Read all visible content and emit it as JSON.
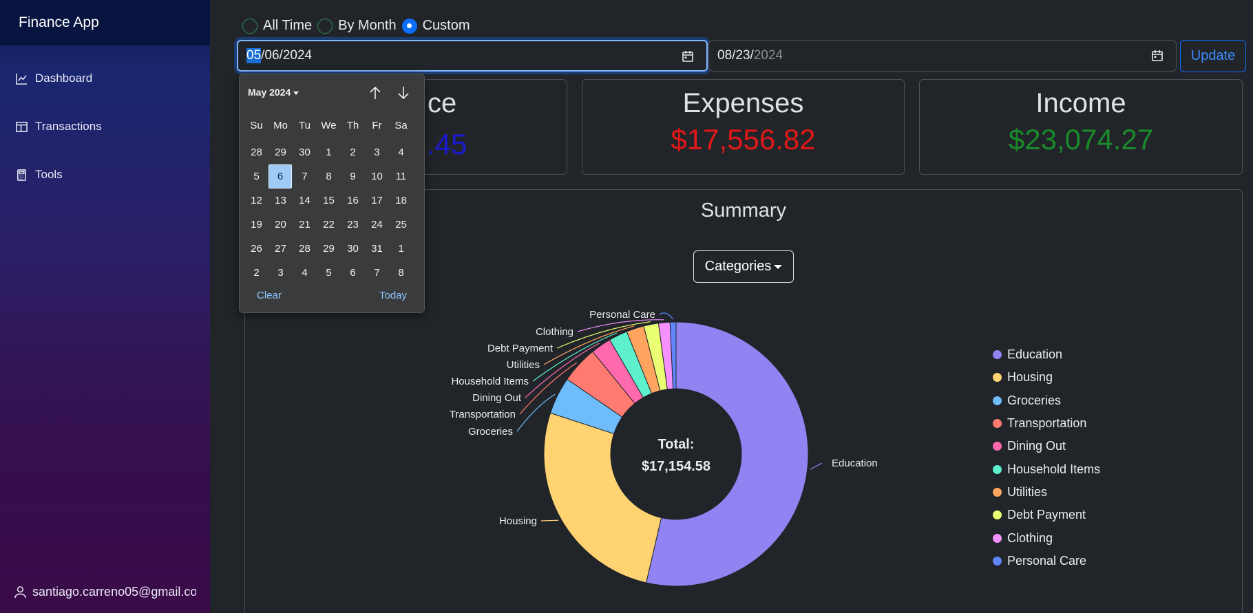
{
  "app": {
    "title": "Finance App"
  },
  "sidebar": {
    "items": [
      {
        "label": "Dashboard",
        "icon": "chart-line-icon"
      },
      {
        "label": "Transactions",
        "icon": "table-icon"
      },
      {
        "label": "Tools",
        "icon": "calculator-icon"
      }
    ],
    "user_email": "santiago.carreno05@gmail.com"
  },
  "filters": {
    "options": [
      "All Time",
      "By Month",
      "Custom"
    ],
    "selected": "Custom",
    "start_date": {
      "month": "05",
      "rest": "/06/2024"
    },
    "end_date": {
      "typed": "08/23/",
      "placeholder_part": "2024"
    },
    "update_label": "Update"
  },
  "cards": {
    "balance": {
      "title": "Balance",
      "visible_title": "ce",
      "visible_value": ".45",
      "color": "#1a1ad0"
    },
    "expenses": {
      "title": "Expenses",
      "value": "$17,556.82",
      "color": "#e01818"
    },
    "income": {
      "title": "Income",
      "value": "$23,074.27",
      "color": "#1a8a2a"
    }
  },
  "summary": {
    "title": "Summary",
    "dropdown_label": "Categories"
  },
  "chart_data": {
    "type": "pie",
    "variant": "donut",
    "center_label": [
      "Total:",
      "$17,154.58"
    ],
    "total": 17154.58,
    "categories": [
      "Education",
      "Housing",
      "Groceries",
      "Transportation",
      "Dining Out",
      "Household Items",
      "Utilities",
      "Debt Payment",
      "Clothing",
      "Personal Care"
    ],
    "values": [
      9200,
      4530,
      780,
      780,
      430,
      390,
      370,
      310,
      240,
      125
    ],
    "colors": [
      "#9184f2",
      "#ffd272",
      "#6fbcfa",
      "#ff7a70",
      "#ff6aae",
      "#5ef0cc",
      "#ffa560",
      "#eaff72",
      "#f591ff",
      "#5f86ff"
    ],
    "legend_position": "right"
  },
  "datepicker": {
    "month_label": "May 2024",
    "weekdays": [
      "Su",
      "Mo",
      "Tu",
      "We",
      "Th",
      "Fr",
      "Sa"
    ],
    "days": [
      "28",
      "29",
      "30",
      "1",
      "2",
      "3",
      "4",
      "5",
      "6",
      "7",
      "8",
      "9",
      "10",
      "11",
      "12",
      "13",
      "14",
      "15",
      "16",
      "17",
      "18",
      "19",
      "20",
      "21",
      "22",
      "23",
      "24",
      "25",
      "26",
      "27",
      "28",
      "29",
      "30",
      "31",
      "1",
      "2",
      "3",
      "4",
      "5",
      "6",
      "7",
      "8"
    ],
    "selected_day": "6",
    "clear_label": "Clear",
    "today_label": "Today"
  }
}
